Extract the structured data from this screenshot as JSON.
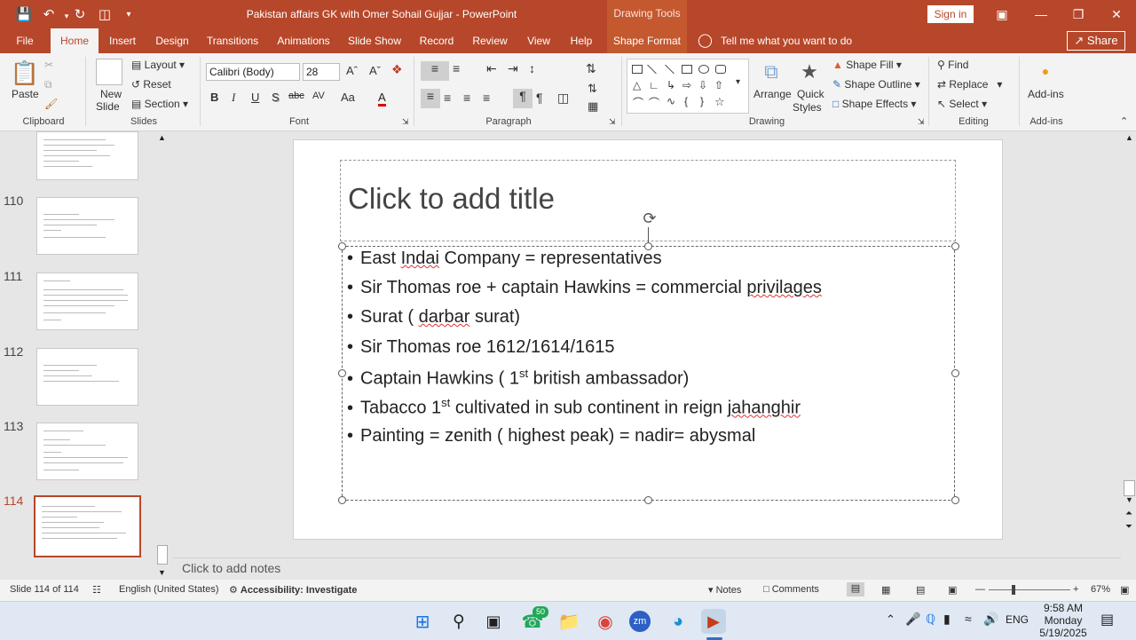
{
  "app": {
    "title": "Pakistan affairs GK with Omer Sohail Gujjar  -  PowerPoint",
    "contextual": "Drawing Tools",
    "signin": "Sign in",
    "share": "Share"
  },
  "tabs": [
    "File",
    "Home",
    "Insert",
    "Design",
    "Transitions",
    "Animations",
    "Slide Show",
    "Record",
    "Review",
    "View",
    "Help",
    "Shape Format"
  ],
  "tell_me": "Tell me what you want to do",
  "ribbon": {
    "clipboard": {
      "paste": "Paste",
      "label": "Clipboard"
    },
    "slides": {
      "new_slide": "New",
      "new_slide2": "Slide",
      "layout": "Layout",
      "reset": "Reset",
      "section": "Section",
      "label": "Slides"
    },
    "font": {
      "family": "Calibri (Body)",
      "size": "28",
      "label": "Font",
      "bold": "B",
      "italic": "I",
      "underline": "U",
      "shadow": "S",
      "strike": "abc",
      "spacing": "AV",
      "case": "Aa",
      "color": "A"
    },
    "paragraph": {
      "label": "Paragraph"
    },
    "drawing": {
      "arrange": "Arrange",
      "quick1": "Quick",
      "quick2": "Styles",
      "fill": "Shape Fill",
      "outline": "Shape Outline",
      "effects": "Shape Effects",
      "label": "Drawing"
    },
    "editing": {
      "find": "Find",
      "replace": "Replace",
      "select": "Select",
      "label": "Editing"
    },
    "addins": {
      "btn": "Add-ins",
      "label": "Add-ins"
    }
  },
  "thumbnails": [
    {
      "num": "",
      "lines": 6
    },
    {
      "num": "110",
      "lines": 5
    },
    {
      "num": "111",
      "lines": 7
    },
    {
      "num": "112",
      "lines": 4
    },
    {
      "num": "113",
      "lines": 7
    },
    {
      "num": "114",
      "lines": 7
    }
  ],
  "slide": {
    "title_placeholder": "Click to add title",
    "bullets": [
      {
        "pre": "East ",
        "sq": "Indai",
        "post": " Company = representatives"
      },
      {
        "pre": "Sir Thomas roe + captain Hawkins = commercial ",
        "sq": "privilages",
        "post": ""
      },
      {
        "pre": "Surat ( ",
        "sq": "darbar",
        "post": " surat)"
      },
      {
        "pre": "Sir Thomas roe 1612/1614/1615",
        "sq": "",
        "post": ""
      },
      {
        "pre": "Captain Hawkins ( 1",
        "sup": "st",
        "sq": "",
        "post": " british ambassador)"
      },
      {
        "pre": "Tabacco 1",
        "sup": "st",
        "mid": " cultivated in sub continent in reign ",
        "sq": "jahanghir",
        "post": ""
      },
      {
        "pre": "Painting = zenith ( highest peak) = nadir= abysmal",
        "sq": "",
        "post": ""
      }
    ]
  },
  "notes_placeholder": "Click to add notes",
  "status": {
    "slide": "Slide 114 of 114",
    "lang": "English (United States)",
    "access": "Accessibility: Investigate",
    "notes": "Notes",
    "comments": "Comments",
    "zoom": "67%"
  },
  "taskbar": {
    "badge": "50",
    "lang": "ENG",
    "time": "9:58 AM",
    "day": "Monday",
    "date": "5/19/2025"
  }
}
